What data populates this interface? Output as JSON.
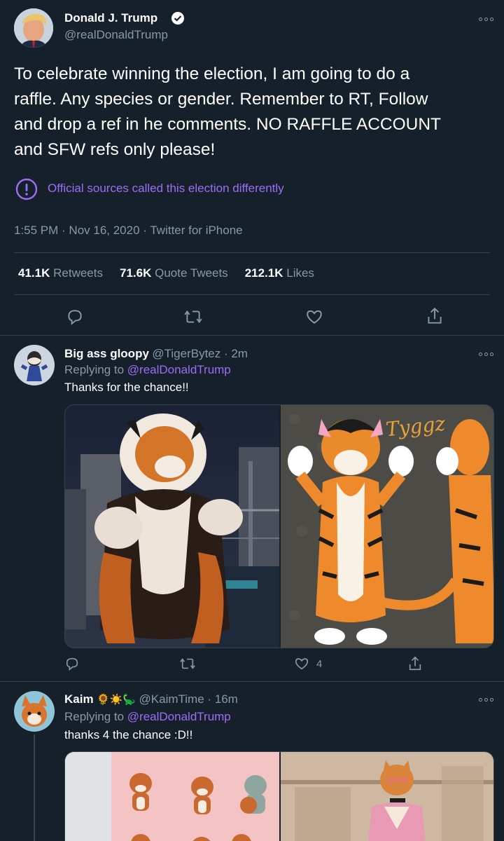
{
  "main_tweet": {
    "display_name": "Donald J. Trump",
    "handle": "@realDonaldTrump",
    "text_line1": "To celebrate winning the election, I am going to do a",
    "text_line2": "raffle. Any species or gender. Remember to RT, Follow",
    "text_line3": "and drop a ref in he comments. NO RAFFLE ACCOUNT",
    "text_line4": "and SFW refs only please!",
    "notice": "Official sources called this election differently",
    "timestamp": "1:55 PM · Nov 16, 2020 · Twitter for iPhone",
    "stats": {
      "retweets_count": "41.1K",
      "retweets_label": "Retweets",
      "quotes_count": "71.6K",
      "quotes_label": "Quote Tweets",
      "likes_count": "212.1K",
      "likes_label": "Likes"
    }
  },
  "reply1": {
    "display_name": "Big ass gloopy",
    "handle_time": "@TigerBytez · 2m",
    "replying_prefix": "Replying to",
    "replying_to": "@realDonaldTrump",
    "text": "Thanks for the chance!!",
    "image_text": "Tyggz",
    "like_count": "4"
  },
  "reply2": {
    "display_name": "Kaim",
    "emoji": "🌻☀️🦕",
    "handle_time": "@KaimTime · 16m",
    "replying_prefix": "Replying to",
    "replying_to": "@realDonaldTrump",
    "text": "thanks 4 the chance :D!!"
  },
  "colors": {
    "background": "#15202b",
    "accent": "#9a6ef5",
    "muted": "#8899a6",
    "verified": "#ffffff"
  },
  "icons": [
    "reply-icon",
    "retweet-icon",
    "like-icon",
    "share-icon",
    "more-icon",
    "verified-icon",
    "alert-icon"
  ]
}
